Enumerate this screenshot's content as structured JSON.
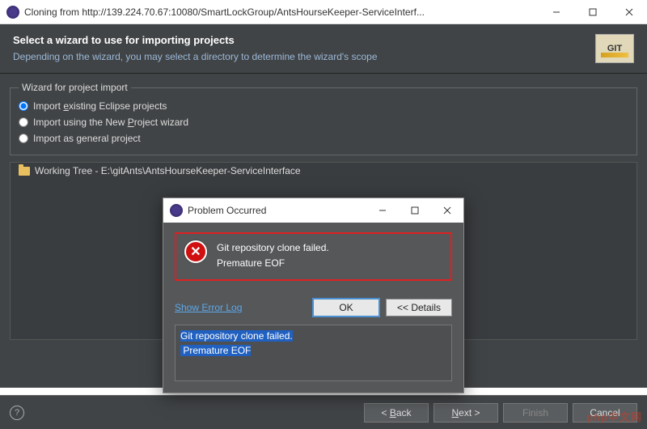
{
  "window": {
    "title": "Cloning from http://139.224.70.67:10080/SmartLockGroup/AntsHourseKeeper-ServiceInterf..."
  },
  "banner": {
    "heading": "Select a wizard to use for importing projects",
    "subtext": "Depending on the wizard, you may select a directory to determine the wizard's scope",
    "logo_text": "GIT"
  },
  "fieldset": {
    "legend": "Wizard for project import",
    "options": [
      "Import existing Eclipse projects",
      "Import using the New Project wizard",
      "Import as general project"
    ]
  },
  "tree": {
    "item": "Working Tree - E:\\gitAnts\\AntsHourseKeeper-ServiceInterface"
  },
  "buttons": {
    "back": "< Back",
    "next": "Next >",
    "finish": "Finish",
    "cancel": "Cancel"
  },
  "modal": {
    "title": "Problem Occurred",
    "error_line1": "Git repository clone failed.",
    "error_line2": "Premature EOF",
    "show_log": "Show Error Log",
    "ok": "OK",
    "details": "<< Details",
    "details_line1": "Git repository clone failed.",
    "details_line2": "Premature EOF"
  },
  "watermark": "php中文网"
}
